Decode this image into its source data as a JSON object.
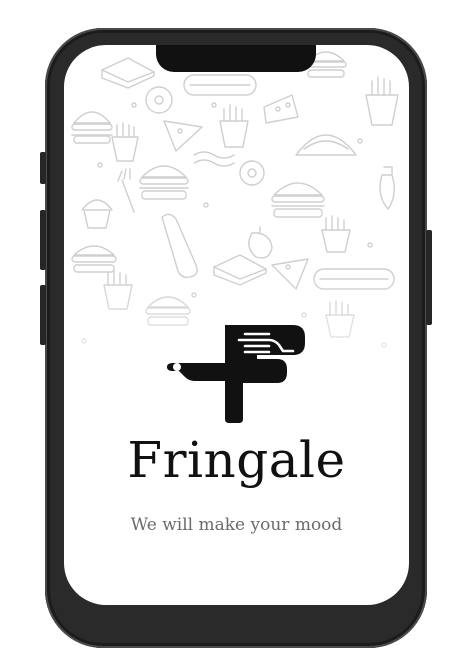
{
  "app": {
    "name": "Fringale",
    "tagline": "We will make your mood"
  },
  "colors": {
    "text_primary": "#111111",
    "text_secondary": "#6b6b6b",
    "logo": "#111111",
    "doodles": "#cfcfcf",
    "device_frame": "#2a2a2a"
  },
  "icons": [
    "cutting-board-fork-logo",
    "food-doodle-pattern"
  ]
}
